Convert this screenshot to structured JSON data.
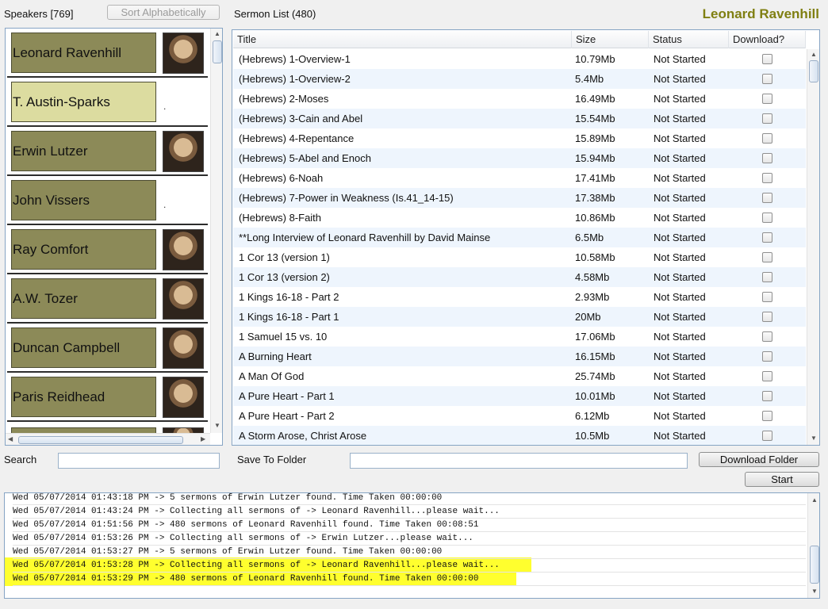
{
  "speakers_label": "Speakers [769]",
  "sort_button": "Sort Alphabetically",
  "sermon_list_label": "Sermon List (480)",
  "selected_speaker_title": "Leonard Ravenhill",
  "speakers": [
    {
      "name": "Leonard Ravenhill",
      "has_photo": true,
      "selected": false
    },
    {
      "name": "T. Austin-Sparks",
      "has_photo": false,
      "selected": true
    },
    {
      "name": "Erwin Lutzer",
      "has_photo": true,
      "selected": false
    },
    {
      "name": "John Vissers",
      "has_photo": false,
      "selected": false
    },
    {
      "name": "Ray Comfort",
      "has_photo": true,
      "selected": false
    },
    {
      "name": "A.W. Tozer",
      "has_photo": true,
      "selected": false
    },
    {
      "name": "Duncan Campbell",
      "has_photo": true,
      "selected": false
    },
    {
      "name": "Paris Reidhead",
      "has_photo": true,
      "selected": false
    }
  ],
  "table": {
    "columns": [
      "Title",
      "Size",
      "Status",
      "Download?"
    ],
    "rows": [
      {
        "title": "(Hebrews) 1-Overview-1",
        "size": "10.79Mb",
        "status": "Not Started"
      },
      {
        "title": "(Hebrews) 1-Overview-2",
        "size": "5.4Mb",
        "status": "Not Started"
      },
      {
        "title": "(Hebrews) 2-Moses",
        "size": "16.49Mb",
        "status": "Not Started"
      },
      {
        "title": "(Hebrews) 3-Cain and Abel",
        "size": "15.54Mb",
        "status": "Not Started"
      },
      {
        "title": "(Hebrews) 4-Repentance",
        "size": "15.89Mb",
        "status": "Not Started"
      },
      {
        "title": "(Hebrews) 5-Abel and Enoch",
        "size": "15.94Mb",
        "status": "Not Started"
      },
      {
        "title": "(Hebrews) 6-Noah",
        "size": "17.41Mb",
        "status": "Not Started"
      },
      {
        "title": "(Hebrews) 7-Power in Weakness (Is.41_14-15)",
        "size": "17.38Mb",
        "status": "Not Started"
      },
      {
        "title": "(Hebrews) 8-Faith",
        "size": "10.86Mb",
        "status": "Not Started"
      },
      {
        "title": "**Long Interview of Leonard Ravenhill by David Mainse",
        "size": "6.5Mb",
        "status": "Not Started"
      },
      {
        "title": "1 Cor 13 (version 1)",
        "size": "10.58Mb",
        "status": "Not Started"
      },
      {
        "title": "1 Cor 13 (version 2)",
        "size": "4.58Mb",
        "status": "Not Started"
      },
      {
        "title": "1 Kings 16-18 - Part 2",
        "size": "2.93Mb",
        "status": "Not Started"
      },
      {
        "title": "1 Kings 16-18 - Part 1",
        "size": "20Mb",
        "status": "Not Started"
      },
      {
        "title": "1 Samuel 15 vs. 10",
        "size": "17.06Mb",
        "status": "Not Started"
      },
      {
        "title": "A Burning Heart",
        "size": "16.15Mb",
        "status": "Not Started"
      },
      {
        "title": "A Man Of God",
        "size": "25.74Mb",
        "status": "Not Started"
      },
      {
        "title": "A Pure Heart - Part 1",
        "size": "10.01Mb",
        "status": "Not Started"
      },
      {
        "title": "A Pure Heart - Part 2",
        "size": "6.12Mb",
        "status": "Not Started"
      },
      {
        "title": "A Storm Arose, Christ Arose",
        "size": "10.5Mb",
        "status": "Not Started"
      }
    ]
  },
  "search_label": "Search",
  "search_value": "",
  "save_to_folder_label": "Save To Folder",
  "save_to_folder_value": "",
  "download_folder_button": "Download Folder",
  "start_button": "Start",
  "log_lines": [
    {
      "text": "Wed 05/07/2014 01:43:18 PM -> 5 sermons of Erwin Lutzer found. Time Taken 00:00:00",
      "highlight": false
    },
    {
      "text": "Wed 05/07/2014 01:43:24 PM -> Collecting all sermons of -> Leonard Ravenhill...please wait...",
      "highlight": false
    },
    {
      "text": "Wed 05/07/2014 01:51:56 PM -> 480 sermons of Leonard Ravenhill found. Time Taken 00:08:51",
      "highlight": false
    },
    {
      "text": "Wed 05/07/2014 01:53:26 PM -> Collecting all sermons of -> Erwin Lutzer...please wait...",
      "highlight": false
    },
    {
      "text": "Wed 05/07/2014 01:53:27 PM -> 5 sermons of Erwin Lutzer found. Time Taken 00:00:00",
      "highlight": false
    },
    {
      "text": "Wed 05/07/2014 01:53:28 PM -> Collecting all sermons of -> Leonard Ravenhill...please wait...",
      "highlight": true
    },
    {
      "text": "Wed 05/07/2014 01:53:29 PM -> 480 sermons of Leonard Ravenhill found. Time Taken 00:00:00",
      "highlight": true
    }
  ],
  "colors": {
    "speaker_tile": "#8c8a58",
    "speaker_tile_selected": "#dcdca0",
    "title_accent": "#7f7f12",
    "highlight": "#ffff2e",
    "row_alt": "#eef5fd"
  }
}
